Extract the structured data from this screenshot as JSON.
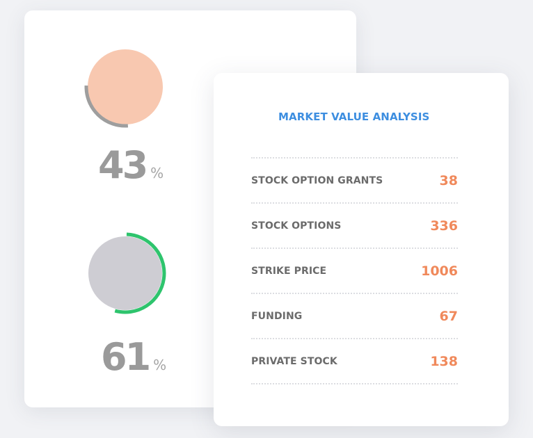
{
  "gauges": [
    {
      "value": "43",
      "unit": "%",
      "progress": 0.43,
      "fill_color": "#f8c8b0",
      "arc_color": "#9e9e9e"
    },
    {
      "value": "61",
      "unit": "%",
      "progress": 0.61,
      "fill_color": "#cecdd3",
      "arc_color": "#2ec46d"
    }
  ],
  "analysis": {
    "title": "MARKET VALUE ANALYSIS",
    "title_color": "#3d8ee0",
    "value_color": "#f0895b",
    "rows": [
      {
        "label": "STOCK OPTION GRANTS",
        "value": "38"
      },
      {
        "label": "STOCK OPTIONS",
        "value": "336"
      },
      {
        "label": "STRIKE PRICE",
        "value": "1006"
      },
      {
        "label": "FUNDING",
        "value": "67"
      },
      {
        "label": "PRIVATE STOCK",
        "value": "138"
      }
    ]
  }
}
